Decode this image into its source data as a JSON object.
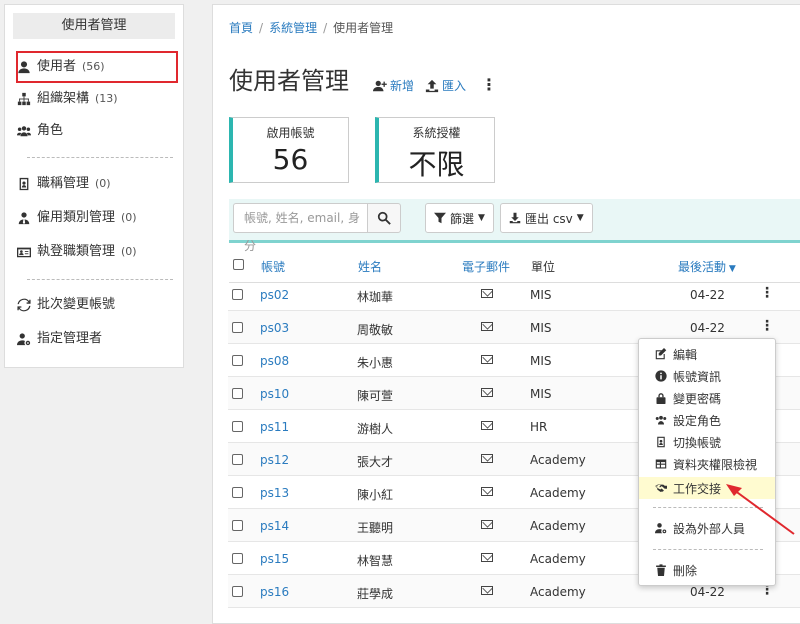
{
  "sidebar": {
    "header": "使用者管理",
    "items": [
      {
        "label": "使用者",
        "count": "(56)"
      },
      {
        "label": "組織架構",
        "count": "(13)"
      },
      {
        "label": "角色",
        "count": ""
      },
      {
        "label": "職稱管理",
        "count": "(0)"
      },
      {
        "label": "僱用類別管理",
        "count": "(0)"
      },
      {
        "label": "執登職類管理",
        "count": "(0)"
      },
      {
        "label": "批次變更帳號",
        "count": ""
      },
      {
        "label": "指定管理者",
        "count": ""
      }
    ]
  },
  "breadcrumb": {
    "home": "首頁",
    "system": "系統管理",
    "current": "使用者管理"
  },
  "page": {
    "title": "使用者管理",
    "add_label": "新增",
    "import_label": "匯入"
  },
  "cards": [
    {
      "label": "啟用帳號",
      "value": "56"
    },
    {
      "label": "系統授權",
      "value": "不限"
    }
  ],
  "toolbar": {
    "search_placeholder": "帳號, 姓名, email, 身分",
    "filter_label": "篩選",
    "export_label": "匯出 csv"
  },
  "table": {
    "headers": {
      "account": "帳號",
      "name": "姓名",
      "email": "電子郵件",
      "unit": "單位",
      "last_active": "最後活動"
    },
    "rows": [
      {
        "account": "ps02",
        "name": "林珈華",
        "unit": "MIS",
        "last": "04-22"
      },
      {
        "account": "ps03",
        "name": "周敬敏",
        "unit": "MIS",
        "last": "04-22"
      },
      {
        "account": "ps08",
        "name": "朱小惠",
        "unit": "MIS",
        "last": ""
      },
      {
        "account": "ps10",
        "name": "陳可萱",
        "unit": "MIS",
        "last": ""
      },
      {
        "account": "ps11",
        "name": "游樹人",
        "unit": "HR",
        "last": ""
      },
      {
        "account": "ps12",
        "name": "張大才",
        "unit": "Academy",
        "last": ""
      },
      {
        "account": "ps13",
        "name": "陳小紅",
        "unit": "Academy",
        "last": ""
      },
      {
        "account": "ps14",
        "name": "王聽明",
        "unit": "Academy",
        "last": ""
      },
      {
        "account": "ps15",
        "name": "林智慧",
        "unit": "Academy",
        "last": ""
      },
      {
        "account": "ps16",
        "name": "莊學成",
        "unit": "Academy",
        "last": "04-22"
      }
    ]
  },
  "menu": {
    "edit": "編輯",
    "account_info": "帳號資訊",
    "change_password": "變更密碼",
    "set_role": "設定角色",
    "switch_account": "切換帳號",
    "folder_permission": "資料夾權限檢視",
    "work_handover": "工作交接",
    "set_external": "設為外部人員",
    "delete": "刪除"
  },
  "colors": {
    "accent": "#2cb6b0",
    "link": "#2a7bbf",
    "highlight": "#e0282e",
    "menu_highlight": "#fffbd0"
  }
}
